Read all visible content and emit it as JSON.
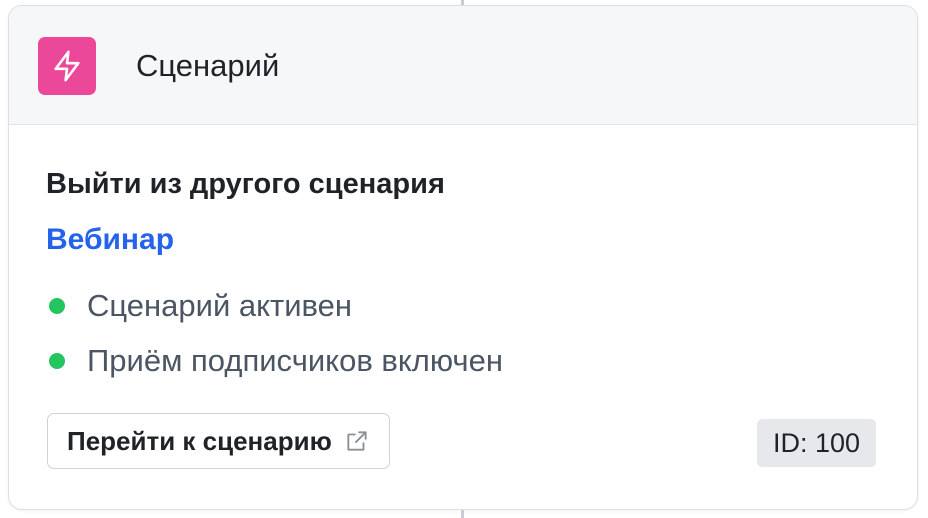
{
  "header": {
    "icon": "lightning-bolt-icon",
    "title": "Сценарий"
  },
  "body": {
    "action_title": "Выйти из другого сценария",
    "scenario_link": "Вебинар",
    "statuses": [
      {
        "label": "Сценарий активен",
        "color": "#22c55e"
      },
      {
        "label": "Приём подписчиков включен",
        "color": "#22c55e"
      }
    ],
    "goto_button_label": "Перейти к сценарию",
    "goto_button_icon": "external-link-icon",
    "id_badge": "ID: 100"
  },
  "colors": {
    "accent_icon_bg": "#ec4899",
    "link": "#2563eb",
    "status_active": "#22c55e"
  }
}
